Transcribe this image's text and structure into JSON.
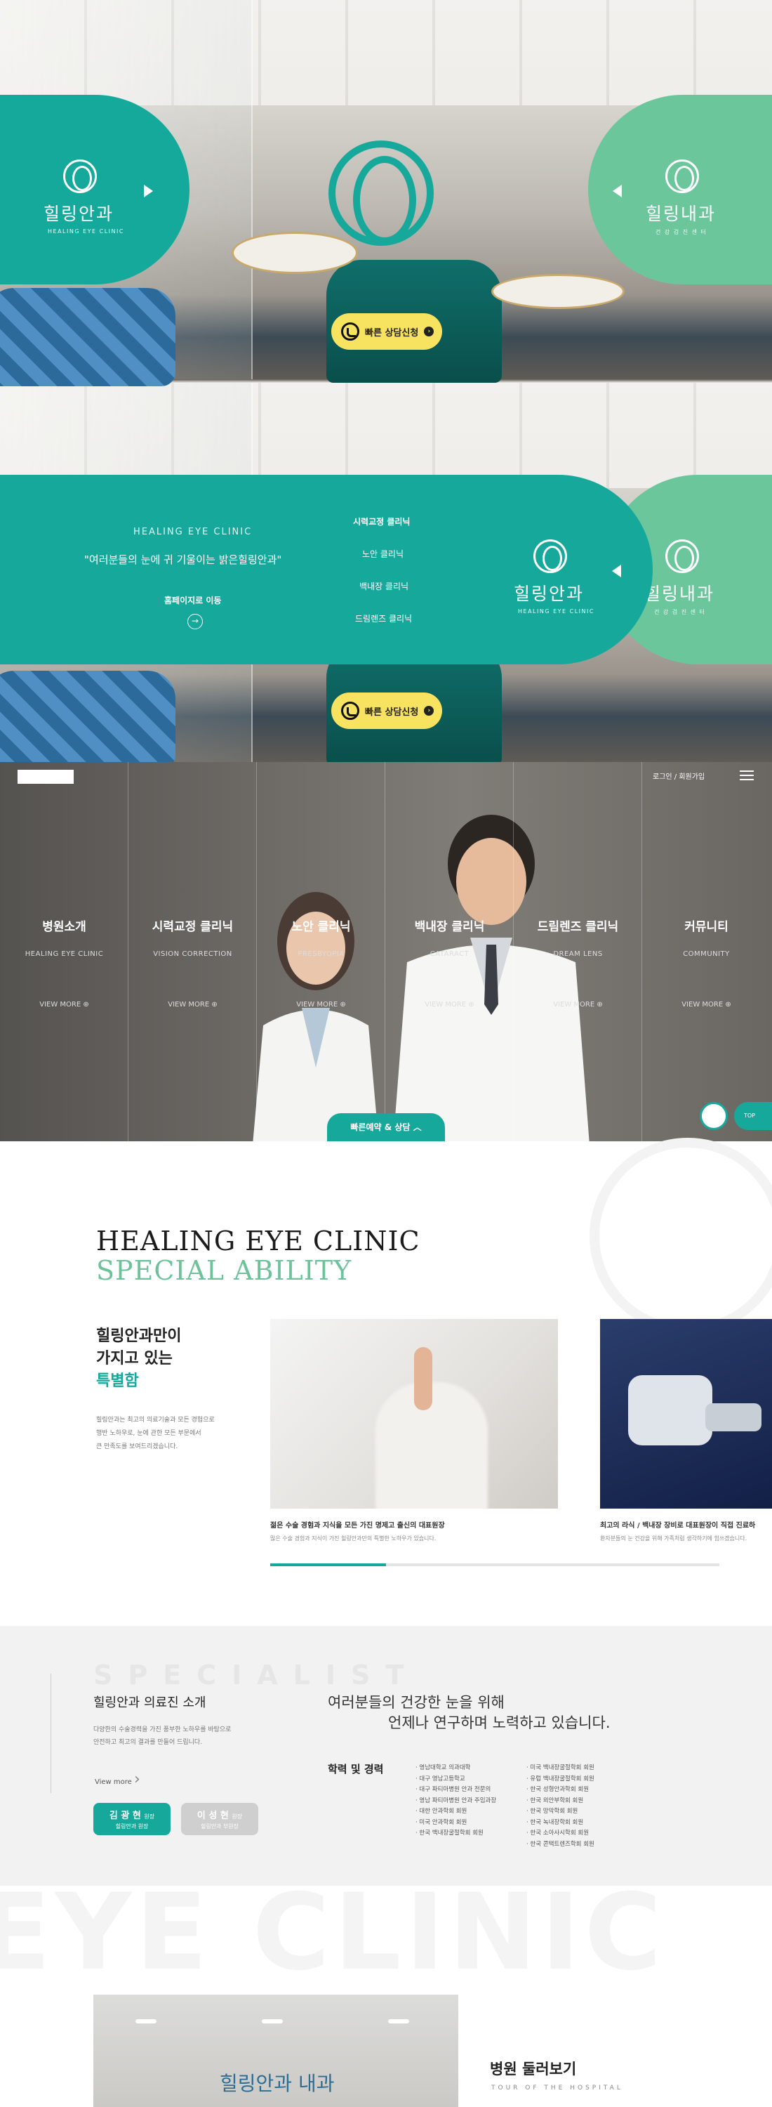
{
  "hero": {
    "left_pill": {
      "title": "힐링안과",
      "subtitle": "HEALING EYE CLINIC"
    },
    "right_pill": {
      "title": "힐링내과",
      "subtitle": "건 강 검 진 센 터"
    },
    "consult_button": "빠른 상담신청"
  },
  "panel": {
    "brand": "HEALING EYE CLINIC",
    "quote": "\"여러분들의 눈에  귀 기울이는 밝은힐링안과\"",
    "homepage_link": "홈페이지로 이동",
    "menu": [
      "시력교정 클리닉",
      "노안 클리닉",
      "백내장 클리닉",
      "드림렌즈 클리닉"
    ],
    "logo_title": "힐링안과",
    "logo_subtitle": "HEALING EYE CLINIC",
    "right_title": "힐링내과",
    "right_subtitle": "건 강 검 진 센 터"
  },
  "clinics": {
    "login": "로그인 / 회원가입",
    "columns": [
      {
        "title": "병원소개",
        "sub": "HEALING EYE CLINIC",
        "more": "VIEW MORE"
      },
      {
        "title": "시력교정 클리닉",
        "sub": "VISION CORRECTION",
        "more": "VIEW MORE"
      },
      {
        "title": "노안 클리닉",
        "sub": "PRESBYOPIA",
        "more": "VIEW MORE"
      },
      {
        "title": "백내장 클리닉",
        "sub": "CATARACT",
        "more": "VIEW MORE"
      },
      {
        "title": "드림렌즈 클리닉",
        "sub": "DREAM LENS",
        "more": "VIEW MORE"
      },
      {
        "title": "커뮤니티",
        "sub": "COMMUNITY",
        "more": "VIEW MORE"
      }
    ],
    "quick_reserve": "빠른예약 & 상담",
    "top_label": "TOP"
  },
  "special": {
    "heading1": "HEALING EYE CLINIC",
    "heading2": "SPECIAL ABILITY",
    "title_line1": "힐링안과만이",
    "title_line2": "가지고 있는",
    "title_line3": "특별함",
    "desc_line1": "힐링안과는 최고의 의료기술과 모든 경험으로",
    "desc_line2": "행반 노하우로, 눈에 관한 모든 부문에서",
    "desc_line3": "큰 만족도를 보여드리겠습니다.",
    "card1_caption": "젊은 수술 경험과 지식을 모든 가진 명제고 출신의 대표원장",
    "card1_sub": "많은 수술 경험과 지식이 가진 힐링안과만의 특별한 노하우가 있습니다.",
    "card2_caption": "최고의 라식 / 백내장 장비로 대표원장이 직접 진료하",
    "card2_sub": "환자분들의 눈 건강을 위해 가족처럼 생각하기에 힘쓰겠습니다."
  },
  "specialist": {
    "watermark": "SPECIALIST",
    "title": "힐링안과 의료진 소개",
    "desc_line1": "다양한의 수술경력을 가진 풍부한 노하우를 바탕으로",
    "desc_line2": "안전하고 최고의 결과를 만들어 드립니다.",
    "view_more": "View more",
    "doctor1_name": "김 광 현",
    "doctor1_role": "원장",
    "doctor1_sub": "힐링안과 원장",
    "doctor2_name": "이 성 현",
    "doctor2_role": "원장",
    "doctor2_sub": "힐링안과 부원장",
    "headline1": "여러분들의 건강한 눈을 위해",
    "headline2": "언제나 연구하며 노력하고 있습니다.",
    "career_label": "학력 및 경력",
    "career_left": [
      "· 영남대학교 의과대학",
      "· 대구 영남고등학교",
      "· 대구 파티마병원 안과 전문의",
      "· 영남 파티마병원 안과 주임과장",
      "· 대한 안과학회 회원",
      "· 미국 안과학회 회원",
      "· 한국 백내장굴절학회 회원"
    ],
    "career_right": [
      "· 미국 백내장굴절학회 회원",
      "· 유럽 백내장굴절학회 회원",
      "· 한국 성형안과학회 회원",
      "· 한국 외안부학회 회원",
      "· 한국 망막학회 회원",
      "· 한국 녹내장학회 회원",
      "· 한국 소아사시학회 회원",
      "· 한국 콘택트렌즈학회 회원"
    ]
  },
  "tour": {
    "watermark": "EYE CLINIC",
    "title": "병원 둘러보기",
    "subtitle": "TOUR OF THE HOSPITAL",
    "sign": "힐링안과 내과"
  },
  "colors": {
    "teal": "#16a99b",
    "mint": "#6cc69c",
    "yellow": "#f8e360",
    "gray_btn": "#cfcfcf"
  }
}
